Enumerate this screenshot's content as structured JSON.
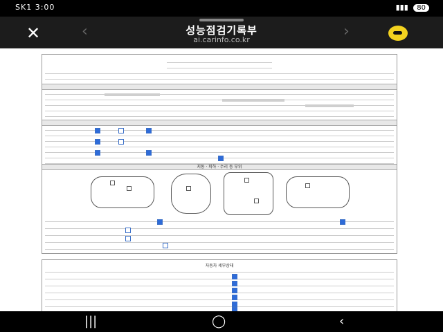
{
  "status_bar": {
    "carrier_time": "SK1 3:00",
    "battery": "80"
  },
  "browser": {
    "title": "성능점검기록부",
    "url": "ai.carinfo.co.kr",
    "close_icon": "close-icon",
    "back_icon": "back-chevron-icon",
    "forward_icon": "forward-chevron-icon",
    "kakao_icon": "kakao-talk-icon"
  },
  "document": {
    "section_diagram": "지동 · 피하 · 수리 등 부위",
    "section_detail": "자동차 세부상태"
  },
  "nav_bar": {
    "recents_icon": "recents-icon",
    "home_icon": "home-icon",
    "back_icon": "back-icon"
  }
}
